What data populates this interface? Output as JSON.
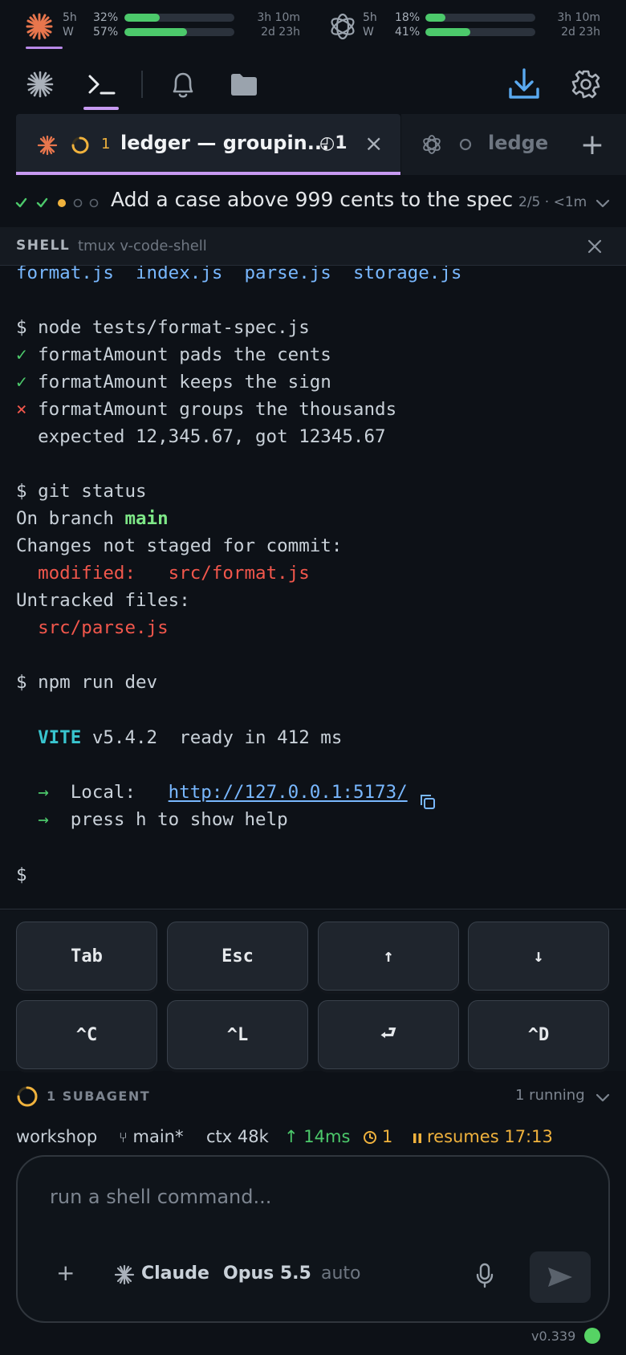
{
  "usage": {
    "providers": [
      {
        "name": "claude",
        "icon": "claude-sunburst-icon",
        "rows": [
          {
            "label": "5h",
            "pct": "32%",
            "fraction": 0.32,
            "reset": "3h 10m"
          },
          {
            "label": "W",
            "pct": "57%",
            "fraction": 0.57,
            "reset": "2d 23h"
          }
        ]
      },
      {
        "name": "openai",
        "icon": "openai-knot-icon",
        "rows": [
          {
            "label": "5h",
            "pct": "18%",
            "fraction": 0.18,
            "reset": "3h 10m"
          },
          {
            "label": "W",
            "pct": "41%",
            "fraction": 0.41,
            "reset": "2d 23h"
          }
        ]
      }
    ]
  },
  "toolbar": {
    "items": [
      "sparkle-icon",
      "terminal-icon",
      "bell-icon",
      "folder-icon"
    ],
    "active": "terminal-icon",
    "right": [
      "download-icon",
      "gear-icon"
    ]
  },
  "tabs": {
    "active": {
      "icon": "claude-sunburst-icon",
      "count": "1",
      "title": "ledger — groupin...",
      "clock_count": "◴1",
      "close": "×"
    },
    "inactive": {
      "icon": "openai-knot-icon",
      "title": "ledge"
    },
    "add": "+"
  },
  "task": {
    "steps": [
      "done",
      "done",
      "active",
      "pending",
      "pending"
    ],
    "title": "Add a case above 999 cents to the spec",
    "meta": "2/5 · <1m"
  },
  "shell": {
    "label": "SHELL",
    "session": "tmux v-code-shell"
  },
  "terminal": {
    "files": [
      "format.js",
      "index.js",
      "parse.js",
      "storage.js"
    ],
    "cmd1": "$ node tests/format-spec.js",
    "pass1": "formatAmount pads the cents",
    "pass2": "formatAmount keeps the sign",
    "fail1": "formatAmount groups the thousands",
    "fail_detail": "  expected 12,345.67, got 12345.67",
    "cmd2": "$ git status",
    "branch_prefix": "On branch ",
    "branch": "main",
    "changes": "Changes not staged for commit:",
    "modified_label": "  modified:   ",
    "modified_file": "src/format.js",
    "untracked": "Untracked files:",
    "untracked_file": "  src/parse.js",
    "cmd3": "$ npm run dev",
    "vite": "  VITE",
    "vite_rest": " v5.4.2  ready in 412 ms",
    "local_label": "  Local:   ",
    "local_url": "http://127.0.0.1:5173/",
    "help": "  press h to show help",
    "prompt": "$"
  },
  "keys": [
    {
      "label": "Tab",
      "name": "tab-key"
    },
    {
      "label": "Esc",
      "name": "esc-key"
    },
    {
      "label": "↑",
      "name": "up-arrow-key"
    },
    {
      "label": "↓",
      "name": "down-arrow-key"
    },
    {
      "label": "^C",
      "name": "ctrl-c-key"
    },
    {
      "label": "^L",
      "name": "ctrl-l-key"
    },
    {
      "label": "⮐",
      "name": "enter-key"
    },
    {
      "label": "^D",
      "name": "ctrl-d-key"
    }
  ],
  "subagents": {
    "label": "1 SUBAGENT",
    "running": "1 running"
  },
  "status": {
    "workspace": "workshop",
    "branch": "main*",
    "ctx": "ctx 48k",
    "latency": "↑ 14ms",
    "queue": "1",
    "resumes": "resumes 17:13",
    "colors": {
      "ok": "#4cc96b",
      "warn": "#f0b23d"
    }
  },
  "composer": {
    "placeholder": "run a shell command...",
    "add": "+",
    "agent": "Claude",
    "model": "Opus 5.5",
    "mode": "auto"
  },
  "footer": {
    "version": "v0.339",
    "status_color": "#56d364"
  }
}
